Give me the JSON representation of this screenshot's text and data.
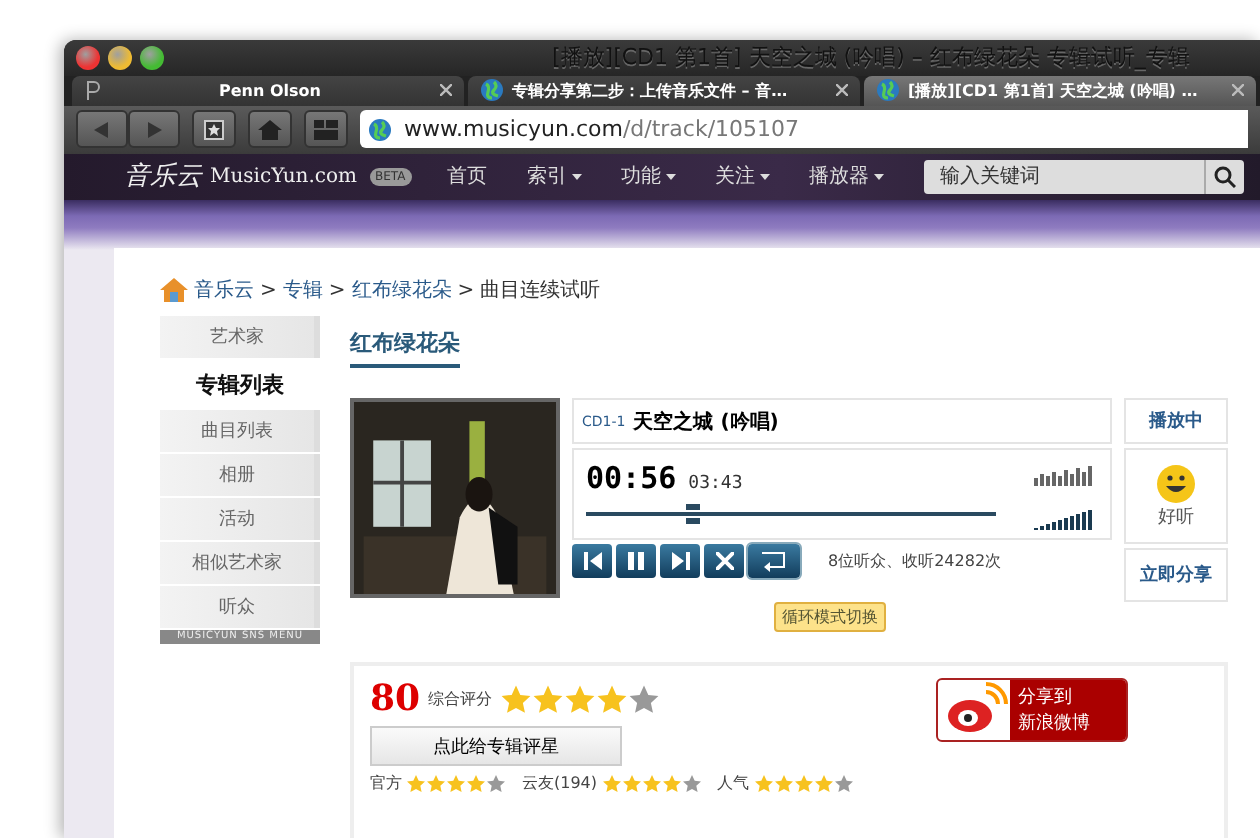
{
  "window": {
    "title": "[播放][CD1 第1首] 天空之城 (吟唱) – 红布绿花朵 专辑试听_专辑"
  },
  "tabs": [
    {
      "label": "Penn Olson",
      "selected": false,
      "kind": "plain"
    },
    {
      "label": "专辑分享第二步：上传音乐文件 – 音…",
      "selected": false,
      "kind": "globe"
    },
    {
      "label": "[播放][CD1 第1首] 天空之城 (吟唱) …",
      "selected": true,
      "kind": "globe"
    }
  ],
  "address": {
    "host": "www.musicyun.com",
    "path": "/d/track/105107"
  },
  "site": {
    "logo": "音乐云",
    "name": "MusicYun.com",
    "badge": "BETA",
    "nav": [
      {
        "label": "首页",
        "menu": false
      },
      {
        "label": "索引",
        "menu": true
      },
      {
        "label": "功能",
        "menu": true
      },
      {
        "label": "关注",
        "menu": true
      },
      {
        "label": "播放器",
        "menu": true
      }
    ],
    "search": {
      "placeholder": "输入关键词"
    }
  },
  "breadcrumb": {
    "separator": ">",
    "items": [
      "音乐云",
      "专辑",
      "红布绿花朵",
      "曲目连续试听"
    ]
  },
  "sidebar": {
    "items": [
      {
        "label": "艺术家",
        "selected": false
      },
      {
        "label": "专辑列表",
        "selected": true
      },
      {
        "label": "曲目列表",
        "selected": false
      },
      {
        "label": "相册",
        "selected": false
      },
      {
        "label": "活动",
        "selected": false
      },
      {
        "label": "相似艺术家",
        "selected": false
      },
      {
        "label": "听众",
        "selected": false
      }
    ],
    "footer": "MUSICYUN SNS MENU"
  },
  "album": {
    "title": "红布绿花朵"
  },
  "player": {
    "track_no": "CD1-1",
    "track": "天空之城 (吟唱)",
    "elapsed": "00:56",
    "total": "03:43",
    "progress": {
      "level": 0.26
    },
    "status": "播放中",
    "mood": "好听",
    "share": "立即分享",
    "stats": "8位听众、收听24282次",
    "tooltip": "循环模式切换"
  },
  "rating": {
    "score": "80",
    "label": "综合评分",
    "stars": 4,
    "rate_button": "点此给专辑评星",
    "sub": [
      {
        "label": "官方",
        "stars": 4
      },
      {
        "label": "云友(194)",
        "stars": 4
      },
      {
        "label": "人气",
        "stars": 4
      }
    ],
    "weibo": {
      "line1": "分享到",
      "line2": "新浪微博"
    }
  }
}
